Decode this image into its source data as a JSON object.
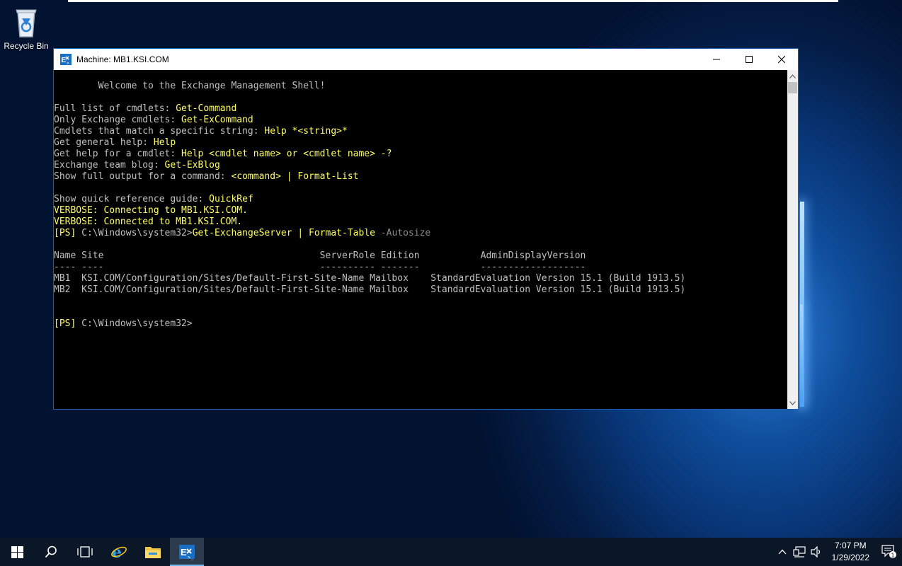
{
  "desktop": {
    "recycle_bin_label": "Recycle Bin"
  },
  "window": {
    "title": "Machine: MB1.KSI.COM",
    "controls": {
      "minimize": "minimize",
      "maximize": "maximize",
      "close": "close"
    }
  },
  "console": {
    "welcome": "        Welcome to the Exchange Management Shell!",
    "help_lines": [
      {
        "label": "Full list of cmdlets: ",
        "cmd": "Get-Command"
      },
      {
        "label": "Only Exchange cmdlets: ",
        "cmd": "Get-ExCommand"
      },
      {
        "label": "Cmdlets that match a specific string: ",
        "cmd": "Help *<string>*"
      },
      {
        "label": "Get general help: ",
        "cmd": "Help"
      },
      {
        "label": "Get help for a cmdlet: ",
        "cmd": "Help <cmdlet name> or <cmdlet name> -?"
      },
      {
        "label": "Exchange team blog: ",
        "cmd": "Get-ExBlog"
      },
      {
        "label": "Show full output for a command: ",
        "cmd": "<command> | Format-List"
      }
    ],
    "quickref_label": "Show quick reference guide: ",
    "quickref_cmd": "QuickRef",
    "verbose_1": "VERBOSE: Connecting to MB1.KSI.COM.",
    "verbose_2": "VERBOSE: Connected to MB1.KSI.COM.",
    "prompt_tag": "[PS]",
    "prompt_path": " C:\\Windows\\system32>",
    "command_1": "Get-ExchangeServer | Format-Table",
    "command_1_param": " -Autosize",
    "table_header": "Name Site                                       ServerRole Edition           AdminDisplayVersion",
    "table_rule": "---- ----                                       ---------- -------           -------------------",
    "table_rows": [
      "MB1  KSI.COM/Configuration/Sites/Default-First-Site-Name Mailbox    StandardEvaluation Version 15.1 (Build 1913.5)",
      "MB2  KSI.COM/Configuration/Sites/Default-First-Site-Name Mailbox    StandardEvaluation Version 15.1 (Build 1913.5)"
    ]
  },
  "taskbar": {
    "time": "7:07 PM",
    "date": "1/29/2022",
    "notification_count": "1",
    "apps": [
      "start",
      "search",
      "task-view",
      "internet-explorer",
      "file-explorer",
      "exchange-management-shell"
    ]
  }
}
